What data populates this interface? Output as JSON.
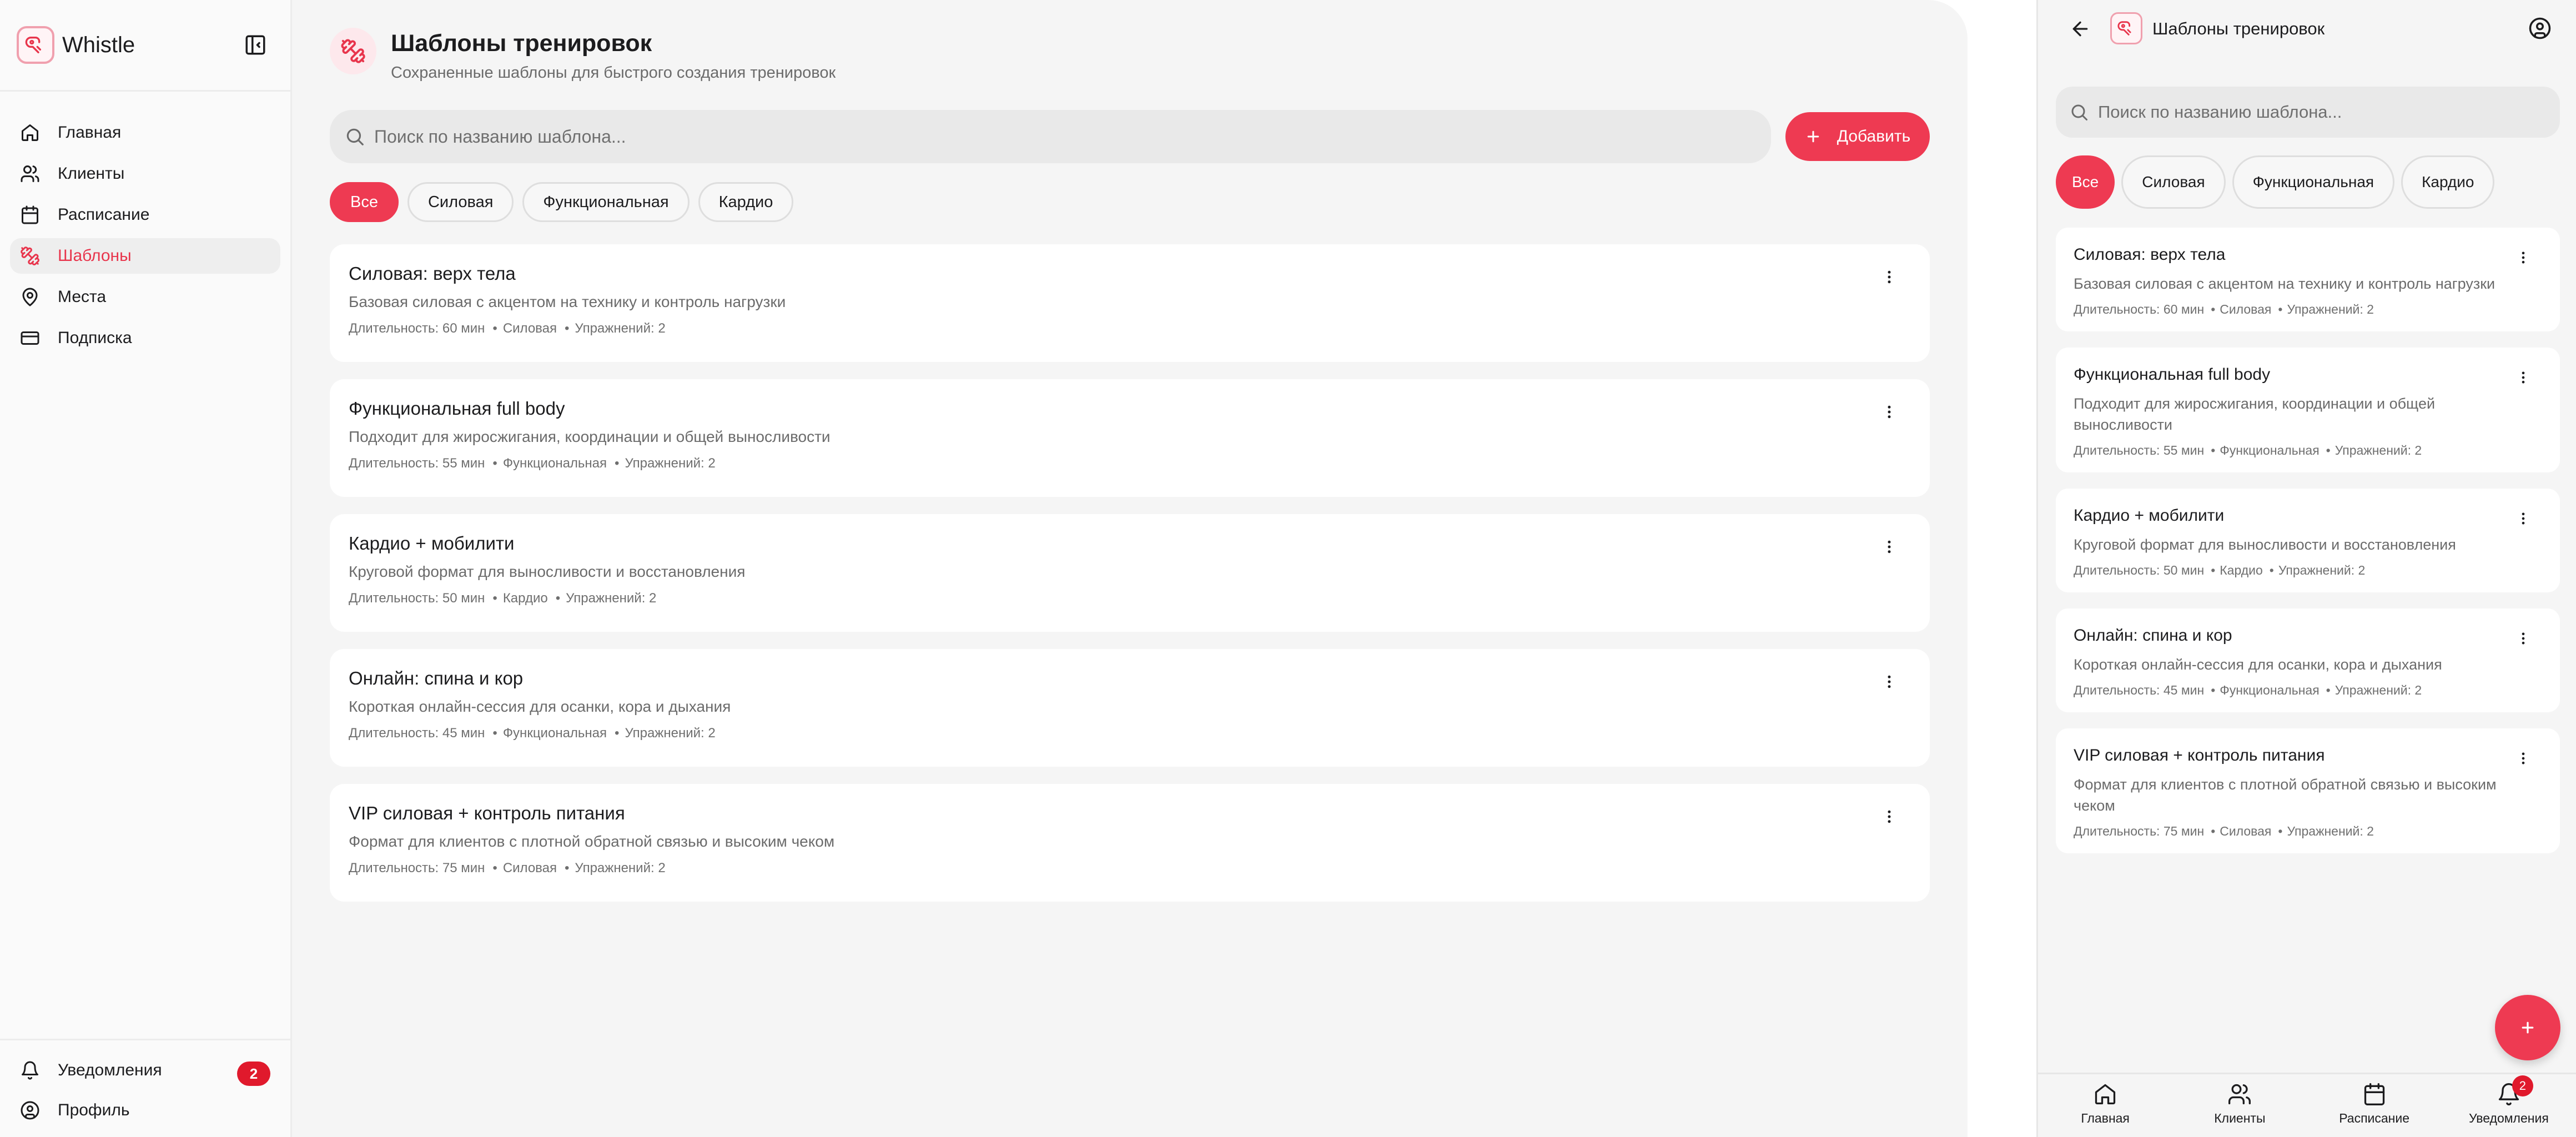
{
  "colors": {
    "accent": "#ee3a52",
    "badge": "#e0192c",
    "active_nav_text": "#e8354c"
  },
  "app": {
    "name": "Whistle"
  },
  "sidebar": {
    "items": [
      {
        "label": "Главная",
        "icon": "home-icon"
      },
      {
        "label": "Клиенты",
        "icon": "users-icon"
      },
      {
        "label": "Расписание",
        "icon": "calendar-icon"
      },
      {
        "label": "Шаблоны",
        "icon": "templates-icon",
        "active": true
      },
      {
        "label": "Места",
        "icon": "map-pin-icon"
      },
      {
        "label": "Подписка",
        "icon": "credit-card-icon"
      }
    ],
    "bottom": {
      "notifications_label": "Уведомления",
      "notifications_count": "2",
      "profile_label": "Профиль"
    }
  },
  "page": {
    "title": "Шаблоны тренировок",
    "subtitle": "Сохраненные шаблоны для быстрого создания тренировок",
    "search_placeholder": "Поиск по названию шаблона...",
    "add_label": "Добавить",
    "filters": [
      "Все",
      "Силовая",
      "Функциональная",
      "Кардио"
    ],
    "active_filter": "Все"
  },
  "templates": [
    {
      "title": "Силовая: верх тела",
      "description": "Базовая силовая с акцентом на технику и контроль нагрузки",
      "duration": "Длительность: 60 мин",
      "type": "Силовая",
      "exercises": "Упражнений: 2"
    },
    {
      "title": "Функциональная full body",
      "description": "Подходит для жиросжигания, координации и общей выносливости",
      "duration": "Длительность: 55 мин",
      "type": "Функциональная",
      "exercises": "Упражнений: 2"
    },
    {
      "title": "Кардио + мобилити",
      "description": "Круговой формат для выносливости и восстановления",
      "duration": "Длительность: 50 мин",
      "type": "Кардио",
      "exercises": "Упражнений: 2"
    },
    {
      "title": "Онлайн: спина и кор",
      "description": "Короткая онлайн-сессия для осанки, кора и дыхания",
      "duration": "Длительность: 45 мин",
      "type": "Функциональная",
      "exercises": "Упражнений: 2"
    },
    {
      "title": "VIP силовая + контроль питания",
      "description": "Формат для клиентов с плотной обратной связью и высоким чеком",
      "duration": "Длительность: 75 мин",
      "type": "Силовая",
      "exercises": "Упражнений: 2"
    }
  ],
  "mobile": {
    "title": "Шаблоны тренировок",
    "search_placeholder": "Поиск по названию шаблона...",
    "tabs": [
      {
        "label": "Главная",
        "icon": "home-icon"
      },
      {
        "label": "Клиенты",
        "icon": "users-icon"
      },
      {
        "label": "Расписание",
        "icon": "calendar-icon"
      },
      {
        "label": "Уведомления",
        "icon": "bell-icon",
        "badge": "2"
      }
    ]
  }
}
